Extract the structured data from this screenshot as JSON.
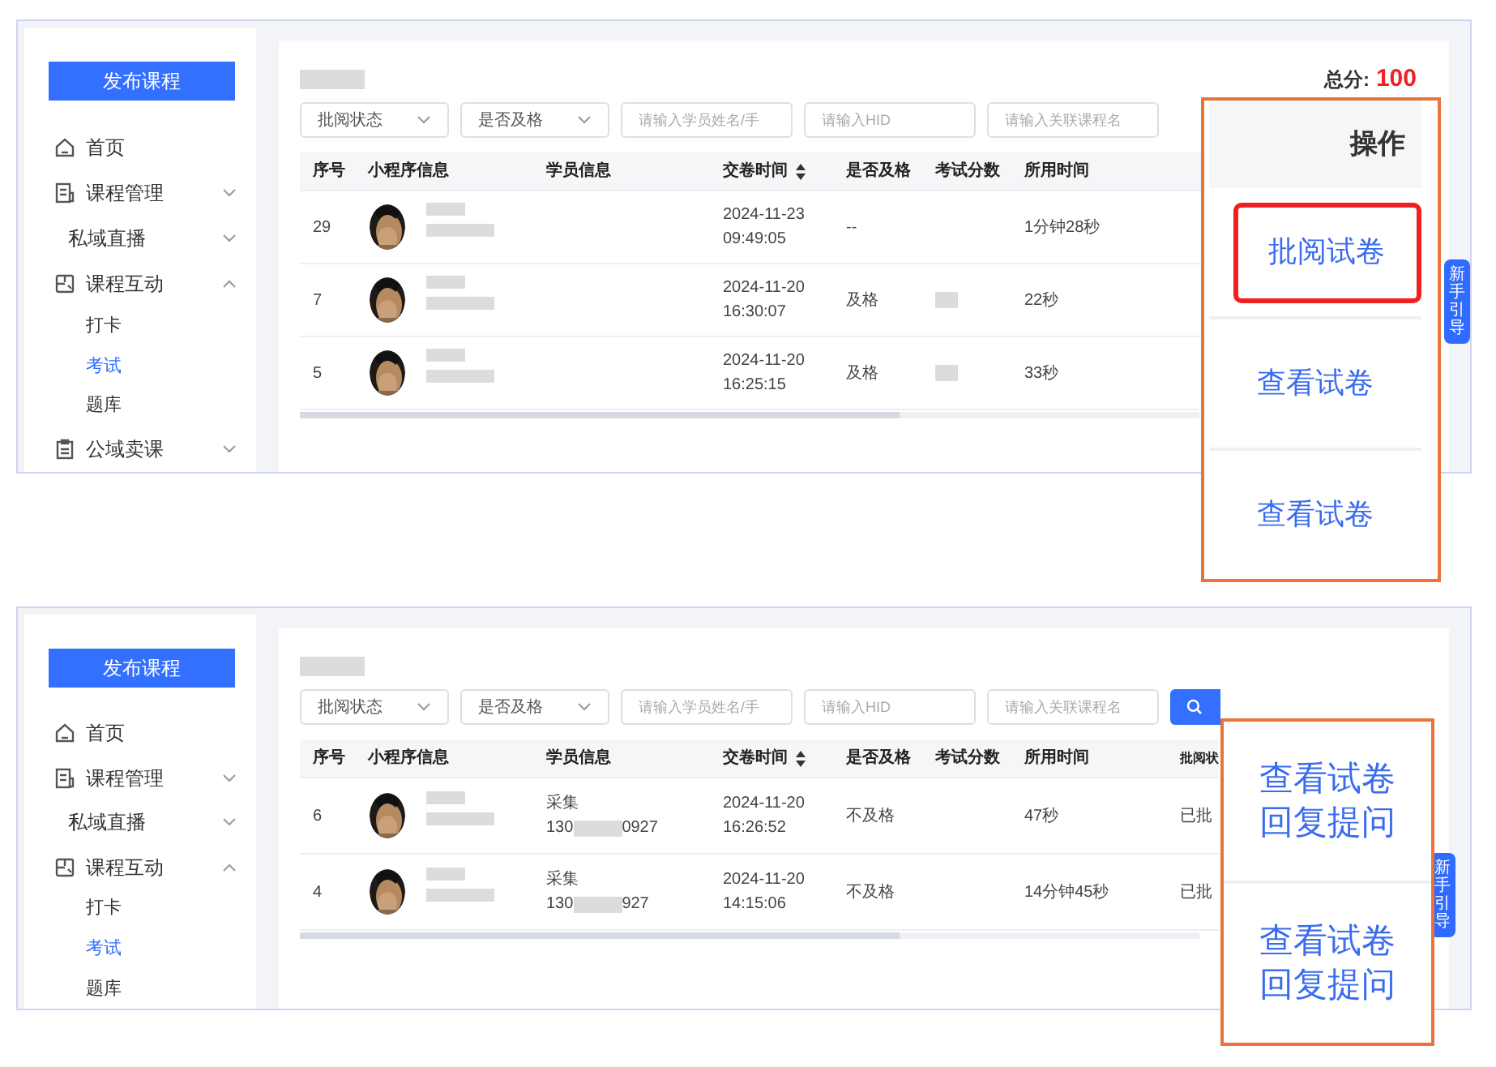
{
  "panels": [
    {
      "sidebar": {
        "publish_button": "发布课程",
        "items": [
          {
            "label": "首页"
          },
          {
            "label": "课程管理",
            "expanded": false
          },
          {
            "label": "私域直播",
            "expanded": false
          },
          {
            "label": "课程互动",
            "expanded": true,
            "children": [
              {
                "label": "打卡",
                "selected": false
              },
              {
                "label": "考试",
                "selected": true
              },
              {
                "label": "题库",
                "selected": false
              }
            ]
          },
          {
            "label": "公域卖课",
            "expanded": false
          }
        ]
      },
      "total_score": {
        "label": "总分:",
        "value": "100"
      },
      "filters": [
        {
          "kind": "select",
          "placeholder": "批阅状态"
        },
        {
          "kind": "select",
          "placeholder": "是否及格"
        },
        {
          "kind": "input",
          "placeholder": "请输入学员姓名/手"
        },
        {
          "kind": "input",
          "placeholder": "请输入HID"
        },
        {
          "kind": "input",
          "placeholder": "请输入关联课程名"
        }
      ],
      "columns": [
        {
          "label": "序号"
        },
        {
          "label": "小程序信息"
        },
        {
          "label": "学员信息"
        },
        {
          "label": "交卷时间",
          "sortable": true
        },
        {
          "label": "是否及格"
        },
        {
          "label": "考试分数"
        },
        {
          "label": "所用时间"
        }
      ],
      "rows": [
        {
          "seq": "29",
          "submit_date": "2024-11-23",
          "submit_time": "09:49:05",
          "passed": "--",
          "score_hidden": false,
          "duration": "1分钟28秒"
        },
        {
          "seq": "7",
          "submit_date": "2024-11-20",
          "submit_time": "16:30:07",
          "passed": "及格",
          "score_hidden": true,
          "duration": "22秒"
        },
        {
          "seq": "5",
          "submit_date": "2024-11-20",
          "submit_time": "16:25:15",
          "passed": "及格",
          "score_hidden": true,
          "duration": "33秒"
        }
      ],
      "callout": {
        "header": "操作",
        "groups": [
          {
            "links": [
              "批阅试卷"
            ],
            "highlighted": true
          },
          {
            "links": [
              "查看试卷"
            ],
            "highlighted": false
          },
          {
            "links": [
              "查看试卷"
            ],
            "highlighted": false
          }
        ]
      },
      "guide_tab": "新手引导"
    },
    {
      "sidebar": {
        "publish_button": "发布课程",
        "items": [
          {
            "label": "首页"
          },
          {
            "label": "课程管理",
            "expanded": false
          },
          {
            "label": "私域直播",
            "expanded": false
          },
          {
            "label": "课程互动",
            "expanded": true,
            "children": [
              {
                "label": "打卡",
                "selected": false
              },
              {
                "label": "考试",
                "selected": true
              },
              {
                "label": "题库",
                "selected": false
              }
            ]
          }
        ]
      },
      "filters": [
        {
          "kind": "select",
          "placeholder": "批阅状态"
        },
        {
          "kind": "select",
          "placeholder": "是否及格"
        },
        {
          "kind": "input",
          "placeholder": "请输入学员姓名/手"
        },
        {
          "kind": "input",
          "placeholder": "请输入HID"
        },
        {
          "kind": "input",
          "placeholder": "请输入关联课程名"
        },
        {
          "kind": "search_button"
        }
      ],
      "columns": [
        {
          "label": "序号"
        },
        {
          "label": "小程序信息"
        },
        {
          "label": "学员信息"
        },
        {
          "label": "交卷时间",
          "sortable": true
        },
        {
          "label": "是否及格"
        },
        {
          "label": "考试分数"
        },
        {
          "label": "所用时间"
        },
        {
          "label": "批阅状"
        }
      ],
      "rows": [
        {
          "seq": "6",
          "student_name": "采集",
          "phone_start": "130",
          "phone_end": "0927",
          "submit_date": "2024-11-20",
          "submit_time": "16:26:52",
          "passed": "不及格",
          "duration": "47秒",
          "status": "已批"
        },
        {
          "seq": "4",
          "student_name": "采集",
          "phone_start": "130",
          "phone_end": "927",
          "submit_date": "2024-11-20",
          "submit_time": "14:15:06",
          "passed": "不及格",
          "duration": "14分钟45秒",
          "status": "已批"
        }
      ],
      "callout": {
        "groups": [
          {
            "links": [
              "查看试卷",
              "回复提问"
            ],
            "highlighted": false
          },
          {
            "links": [
              "查看试卷",
              "回复提问"
            ],
            "highlighted": false
          }
        ]
      },
      "guide_tab": "新手引导"
    }
  ]
}
